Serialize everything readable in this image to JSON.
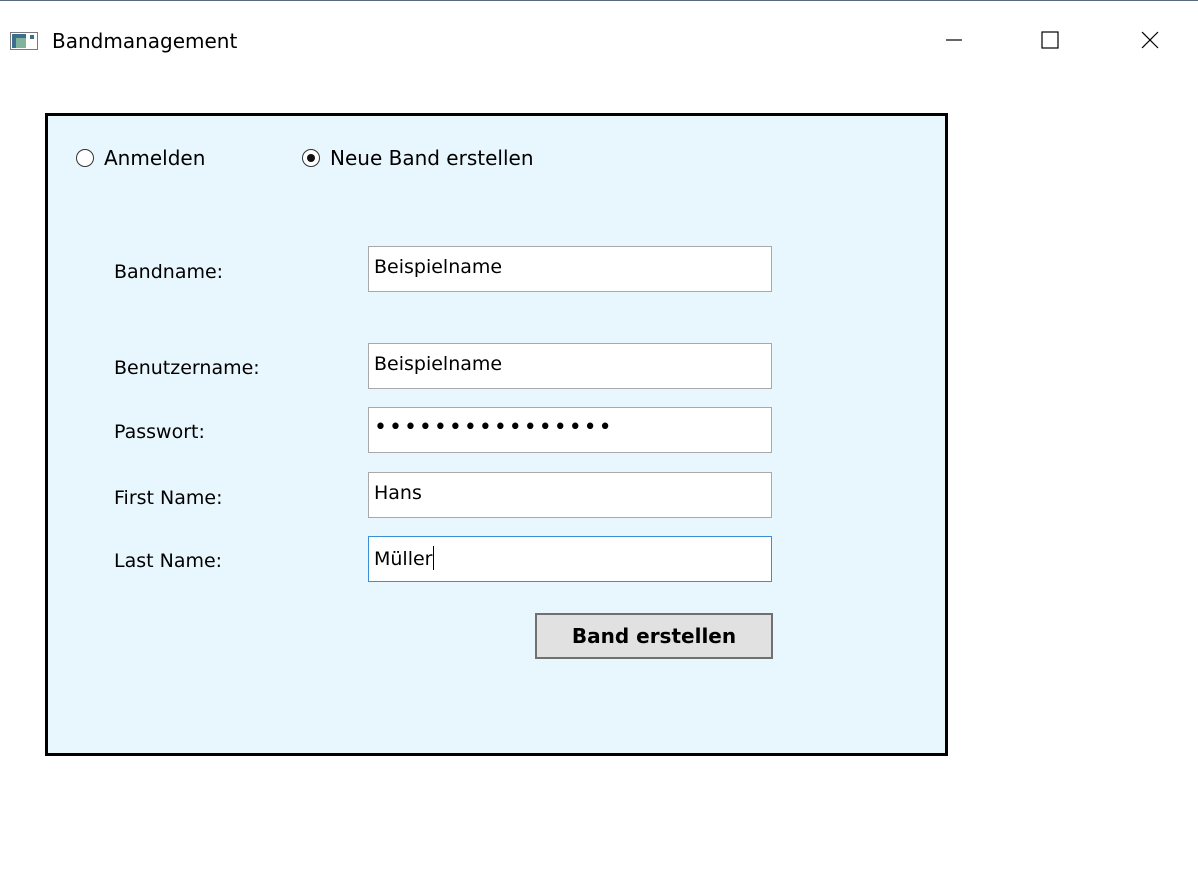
{
  "window": {
    "title": "Bandmanagement"
  },
  "mode": {
    "options": [
      {
        "label": "Anmelden",
        "selected": false
      },
      {
        "label": "Neue Band erstellen",
        "selected": true
      }
    ]
  },
  "form": {
    "bandname": {
      "label": "Bandname:",
      "value": "Beispielname"
    },
    "benutzername": {
      "label": "Benutzername:",
      "value": "Beispielname"
    },
    "passwort": {
      "label": "Passwort:",
      "value": "••••••••••••••••"
    },
    "first_name": {
      "label": "First Name:",
      "value": "Hans"
    },
    "last_name": {
      "label": "Last Name:",
      "value": "Müller"
    },
    "submit_label": "Band erstellen"
  },
  "colors": {
    "panel_bg": "#e8f7fd",
    "focus_border": "#3a8fd8"
  }
}
